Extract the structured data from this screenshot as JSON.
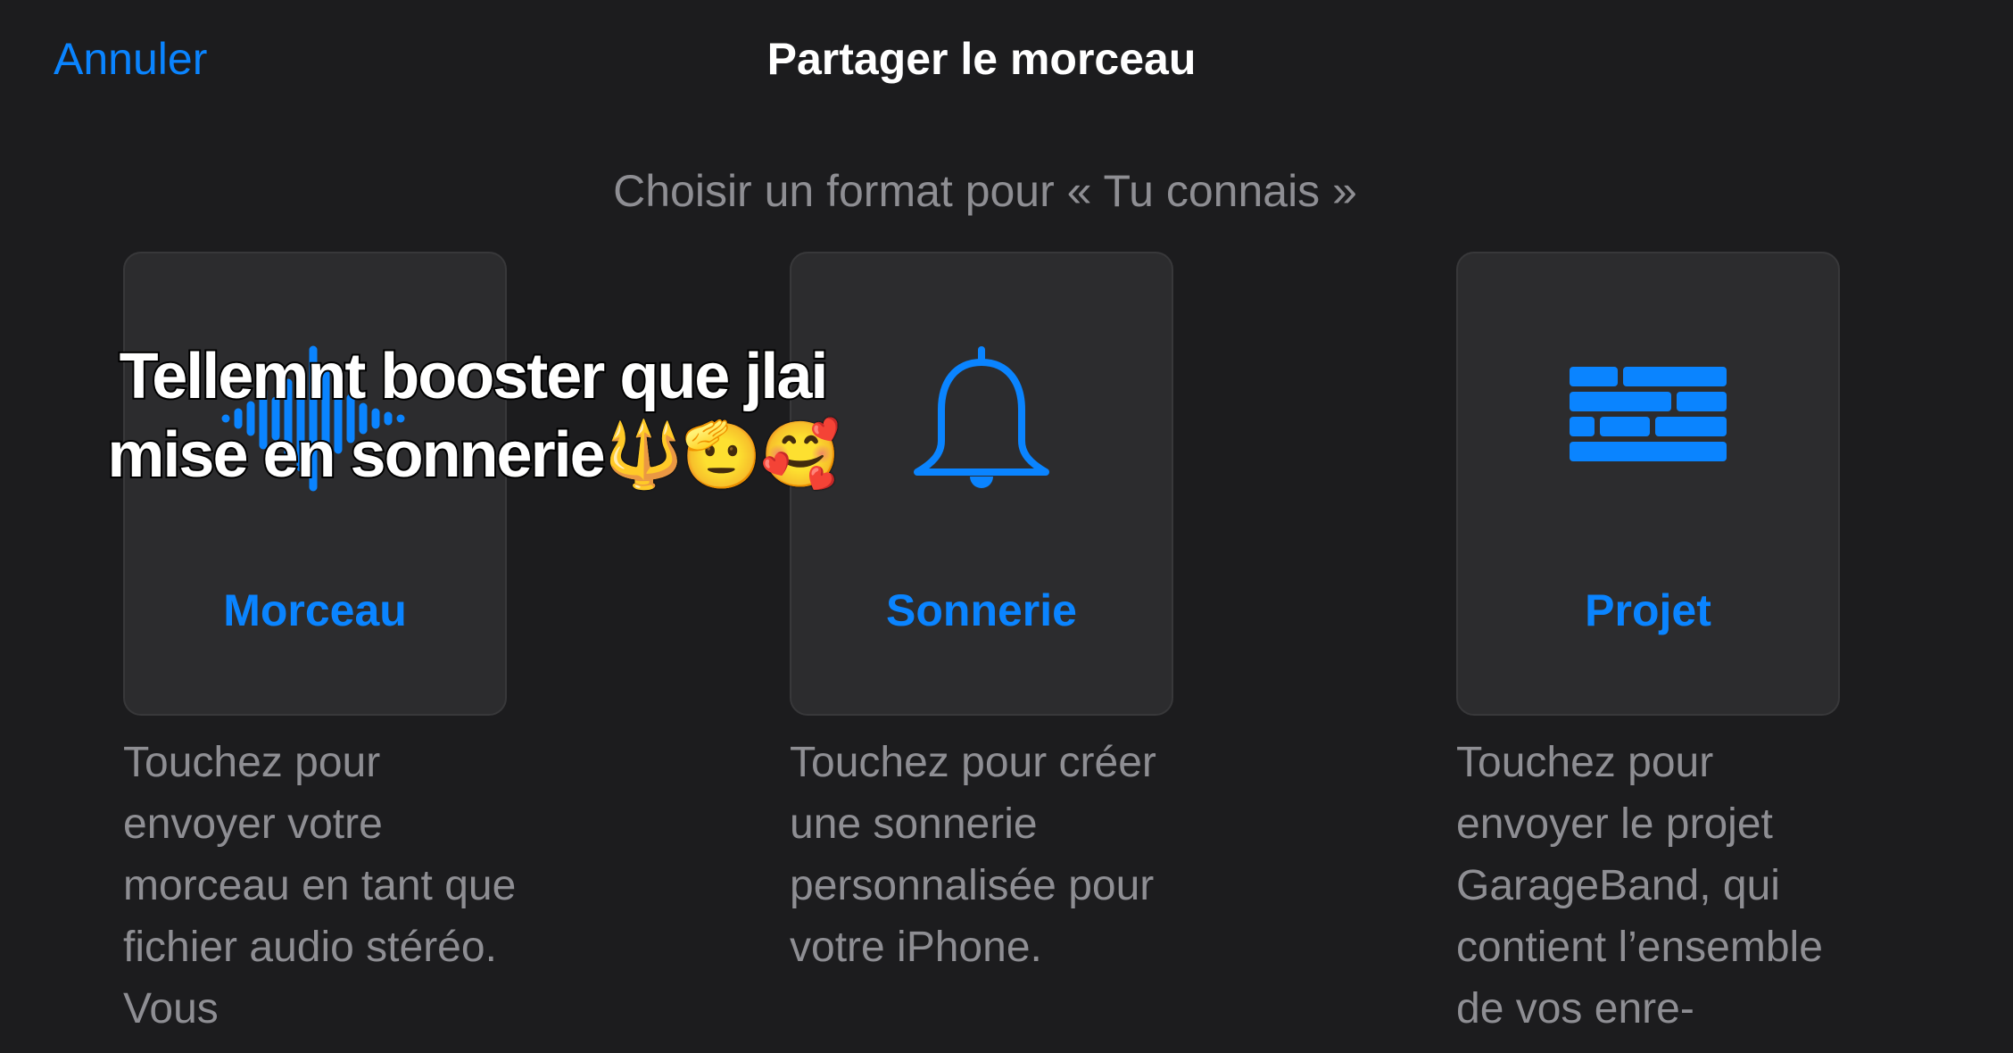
{
  "nav": {
    "cancel_label": "Annuler",
    "title": "Partager le morceau"
  },
  "subtitle": "Choisir un format pour « Tu connais  »",
  "options": [
    {
      "label": "Morceau",
      "icon": "waveform-icon",
      "description": "Touchez pour envoyer votre morceau en tant que fichier audio stéréo. Vous"
    },
    {
      "label": "Sonnerie",
      "icon": "bell-icon",
      "description": "Touchez pour créer une sonnerie personnalisée pour votre iPhone."
    },
    {
      "label": "Projet",
      "icon": "bricks-icon",
      "description": "Touchez pour envoyer le projet GarageBand, qui contient l’ensemble de vos enre-"
    }
  ],
  "overlay_caption": "Tellemnt booster que jlai mise en sonnerie🔱🫡🥰",
  "colors": {
    "background": "#1c1c1e",
    "card": "#2c2c2e",
    "accent": "#0a84ff",
    "secondary_text": "#8e8e93"
  }
}
